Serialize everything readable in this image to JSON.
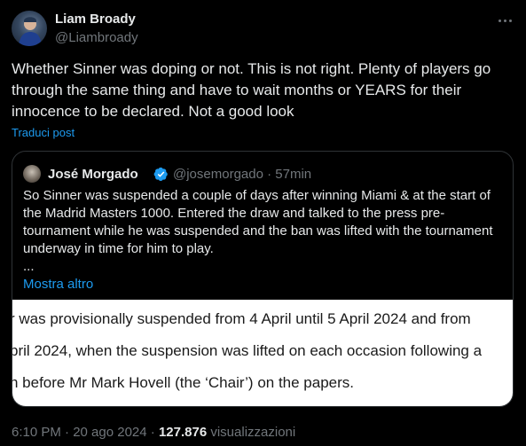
{
  "author": {
    "name": "Liam Broady",
    "handle": "@Liambroady"
  },
  "tweet": {
    "text": "Whether Sinner was doping or not. This is not right. Plenty of players go through the same thing and have to wait months or YEARS for their innocence to be declared. Not a good look",
    "translate_label": "Traduci post"
  },
  "quote": {
    "name": "José Morgado",
    "handle_time": "@josemorgado · 57min",
    "text": "So Sinner was suspended a couple of days after winning Miami & at the start of the Madrid Masters 1000. Entered the draw and talked to the press pre-tournament while he was suspended and the ban was lifted with the tournament underway in time for him to play.",
    "ellipsis": "...",
    "show_more": "Mostra altro",
    "image_lines": [
      "r was provisionally suspended from 4 April until 5 April 2024 and from",
      "pril 2024, when the suspension was lifted on each occasion following a",
      "n before Mr Mark Hovell (the ‘Chair’) on the papers."
    ]
  },
  "meta": {
    "timestamp": "6:10 PM · 20 ago 2024 · ",
    "views_count": "127.876",
    "views_label": " visualizzazioni"
  },
  "colors": {
    "background": "#000000",
    "text": "#e7e9ea",
    "muted": "#71767b",
    "accent": "#1d9bf0",
    "border": "#2f3336"
  },
  "icons": {
    "more": "more-horizontal-icon",
    "verified": "verified-badge-icon"
  }
}
